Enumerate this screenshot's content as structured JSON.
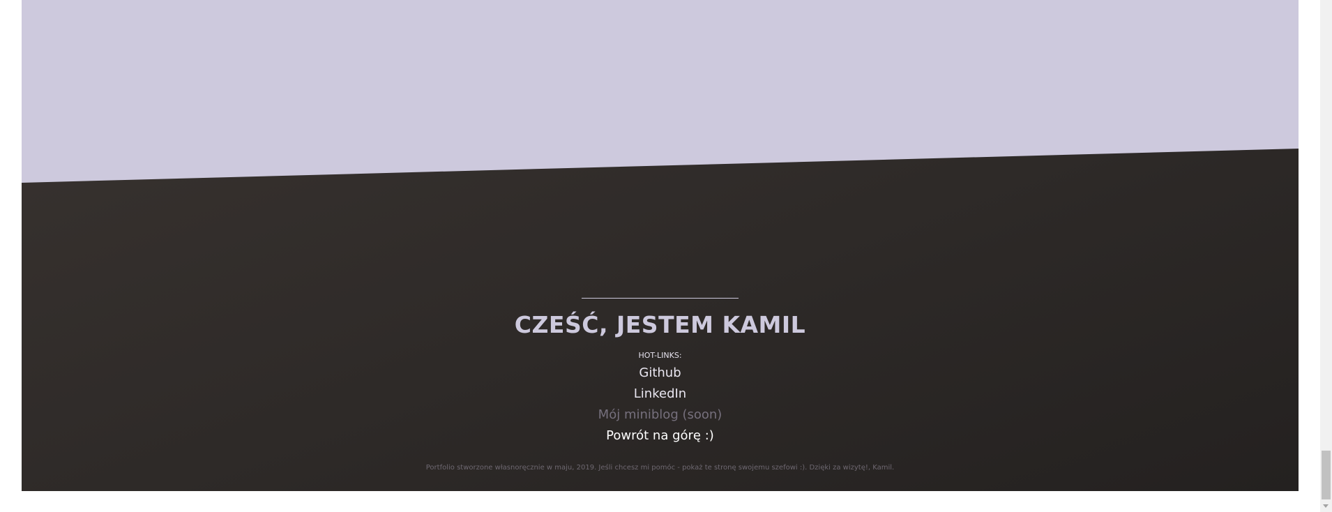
{
  "hero": {
    "background_color": "#cdc9dd"
  },
  "footer": {
    "background_color": "#2e2a28",
    "title": "CZEŚĆ, JESTEM KAMIL",
    "hot_links_label": "HOT-LINKS:",
    "links": [
      {
        "label": "Github"
      },
      {
        "label": "LinkedIn"
      },
      {
        "label": "Mój miniblog (soon)"
      },
      {
        "label": "Powrót na górę :)"
      }
    ],
    "credits": "Portfolio stworzone własnoręcznie w maju, 2019. Jeśli chcesz mi pomóc - pokaż te stronę swojemu szefowi :). Dzięki za wizytę!, Kamil."
  },
  "scrollbar": {
    "scroll_position": "bottom"
  }
}
